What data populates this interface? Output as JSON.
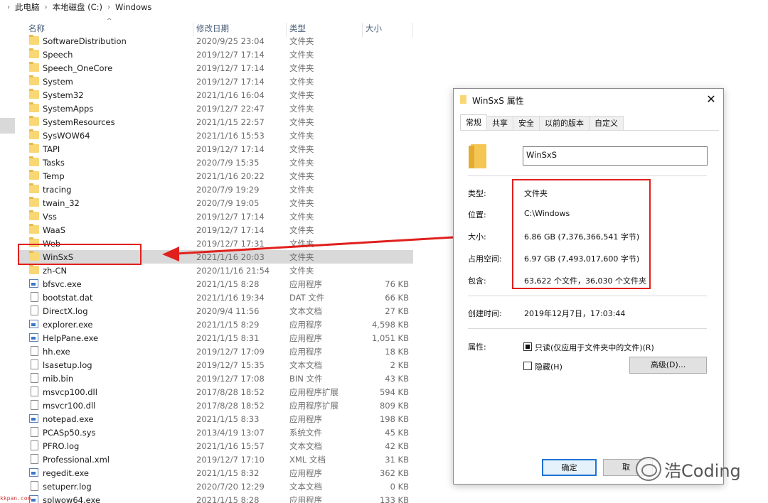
{
  "breadcrumb": [
    "此电脑",
    "本地磁盘 (C:)",
    "Windows"
  ],
  "columns": {
    "name": "名称",
    "date": "修改日期",
    "type": "类型",
    "size": "大小"
  },
  "files": [
    {
      "name": "SoftwareDistribution",
      "date": "2020/9/25 23:04",
      "type": "文件夹",
      "size": "",
      "icon": "folder-icon"
    },
    {
      "name": "Speech",
      "date": "2019/12/7 17:14",
      "type": "文件夹",
      "size": "",
      "icon": "folder-icon"
    },
    {
      "name": "Speech_OneCore",
      "date": "2019/12/7 17:14",
      "type": "文件夹",
      "size": "",
      "icon": "folder-icon"
    },
    {
      "name": "System",
      "date": "2019/12/7 17:14",
      "type": "文件夹",
      "size": "",
      "icon": "folder-icon"
    },
    {
      "name": "System32",
      "date": "2021/1/16 16:04",
      "type": "文件夹",
      "size": "",
      "icon": "folder-icon"
    },
    {
      "name": "SystemApps",
      "date": "2019/12/7 22:47",
      "type": "文件夹",
      "size": "",
      "icon": "folder-icon"
    },
    {
      "name": "SystemResources",
      "date": "2021/1/15 22:57",
      "type": "文件夹",
      "size": "",
      "icon": "folder-icon"
    },
    {
      "name": "SysWOW64",
      "date": "2021/1/16 15:53",
      "type": "文件夹",
      "size": "",
      "icon": "folder-icon"
    },
    {
      "name": "TAPI",
      "date": "2019/12/7 17:14",
      "type": "文件夹",
      "size": "",
      "icon": "folder-icon"
    },
    {
      "name": "Tasks",
      "date": "2020/7/9 15:35",
      "type": "文件夹",
      "size": "",
      "icon": "folder-icon"
    },
    {
      "name": "Temp",
      "date": "2021/1/16 20:22",
      "type": "文件夹",
      "size": "",
      "icon": "folder-icon"
    },
    {
      "name": "tracing",
      "date": "2020/7/9 19:29",
      "type": "文件夹",
      "size": "",
      "icon": "folder-icon"
    },
    {
      "name": "twain_32",
      "date": "2020/7/9 19:05",
      "type": "文件夹",
      "size": "",
      "icon": "folder-icon"
    },
    {
      "name": "Vss",
      "date": "2019/12/7 17:14",
      "type": "文件夹",
      "size": "",
      "icon": "folder-icon"
    },
    {
      "name": "WaaS",
      "date": "2019/12/7 17:14",
      "type": "文件夹",
      "size": "",
      "icon": "folder-icon"
    },
    {
      "name": "Web",
      "date": "2019/12/7 17:31",
      "type": "文件夹",
      "size": "",
      "icon": "folder-icon"
    },
    {
      "name": "WinSxS",
      "date": "2021/1/16 20:03",
      "type": "文件夹",
      "size": "",
      "icon": "folder-icon",
      "selected": true
    },
    {
      "name": "zh-CN",
      "date": "2020/11/16 21:54",
      "type": "文件夹",
      "size": "",
      "icon": "folder-icon"
    },
    {
      "name": "bfsvc.exe",
      "date": "2021/1/15 8:28",
      "type": "应用程序",
      "size": "76 KB",
      "icon": "exe-icon"
    },
    {
      "name": "bootstat.dat",
      "date": "2021/1/16 19:34",
      "type": "DAT 文件",
      "size": "66 KB",
      "icon": "file-icon"
    },
    {
      "name": "DirectX.log",
      "date": "2020/9/4 11:56",
      "type": "文本文档",
      "size": "27 KB",
      "icon": "file-icon"
    },
    {
      "name": "explorer.exe",
      "date": "2021/1/15 8:29",
      "type": "应用程序",
      "size": "4,598 KB",
      "icon": "explorer-icon"
    },
    {
      "name": "HelpPane.exe",
      "date": "2021/1/15 8:31",
      "type": "应用程序",
      "size": "1,051 KB",
      "icon": "help-icon"
    },
    {
      "name": "hh.exe",
      "date": "2019/12/7 17:09",
      "type": "应用程序",
      "size": "18 KB",
      "icon": "help-file-icon"
    },
    {
      "name": "lsasetup.log",
      "date": "2019/12/7 15:35",
      "type": "文本文档",
      "size": "2 KB",
      "icon": "file-icon"
    },
    {
      "name": "mib.bin",
      "date": "2019/12/7 17:08",
      "type": "BIN 文件",
      "size": "43 KB",
      "icon": "file-icon"
    },
    {
      "name": "msvcp100.dll",
      "date": "2017/8/28 18:52",
      "type": "应用程序扩展",
      "size": "594 KB",
      "icon": "dll-icon"
    },
    {
      "name": "msvcr100.dll",
      "date": "2017/8/28 18:52",
      "type": "应用程序扩展",
      "size": "809 KB",
      "icon": "dll-icon"
    },
    {
      "name": "notepad.exe",
      "date": "2021/1/15 8:33",
      "type": "应用程序",
      "size": "198 KB",
      "icon": "exe-icon"
    },
    {
      "name": "PCASp50.sys",
      "date": "2013/4/19 13:07",
      "type": "系统文件",
      "size": "45 KB",
      "icon": "sys-icon"
    },
    {
      "name": "PFRO.log",
      "date": "2021/1/16 15:57",
      "type": "文本文档",
      "size": "42 KB",
      "icon": "file-icon"
    },
    {
      "name": "Professional.xml",
      "date": "2019/12/7 17:10",
      "type": "XML 文档",
      "size": "31 KB",
      "icon": "file-icon"
    },
    {
      "name": "regedit.exe",
      "date": "2021/1/15 8:32",
      "type": "应用程序",
      "size": "362 KB",
      "icon": "regedit-icon"
    },
    {
      "name": "setuperr.log",
      "date": "2020/7/20 12:29",
      "type": "文本文档",
      "size": "0 KB",
      "icon": "file-icon"
    },
    {
      "name": "splwow64.exe",
      "date": "2021/1/15 8:28",
      "type": "应用程序",
      "size": "133 KB",
      "icon": "exe-icon"
    }
  ],
  "dialog": {
    "title": "WinSxS 属性",
    "close": "✕",
    "tabs": [
      "常规",
      "共享",
      "安全",
      "以前的版本",
      "自定义"
    ],
    "active_tab": "常规",
    "name_value": "WinSxS",
    "props": [
      {
        "label": "类型:",
        "value": "文件夹"
      },
      {
        "label": "位置:",
        "value": "C:\\Windows"
      },
      {
        "label": "大小:",
        "value": "6.86 GB (7,376,366,541 字节)"
      },
      {
        "label": "占用空间:",
        "value": "6.97 GB (7,493,017,600 字节)"
      },
      {
        "label": "包含:",
        "value": "63,622 个文件，36,030 个文件夹"
      }
    ],
    "created_label": "创建时间:",
    "created_value": "2019年12月7日，17:03:44",
    "attr_label": "属性:",
    "readonly_label": "只读(仅应用于文件夹中的文件)(R)",
    "readonly_checked": true,
    "hidden_label": "隐藏(H)",
    "hidden_checked": false,
    "advanced_button": "高级(D)...",
    "ok_button": "确定",
    "cancel_button_partial": "取"
  },
  "watermark": {
    "text": "浩Coding"
  },
  "corner_watermark": "kkpan.com",
  "colors": {
    "accent": "#1e73d6",
    "annotation_red": "#e0201d",
    "folder_yellow": "#f8d774",
    "selection_gray": "#d9d9d9"
  }
}
